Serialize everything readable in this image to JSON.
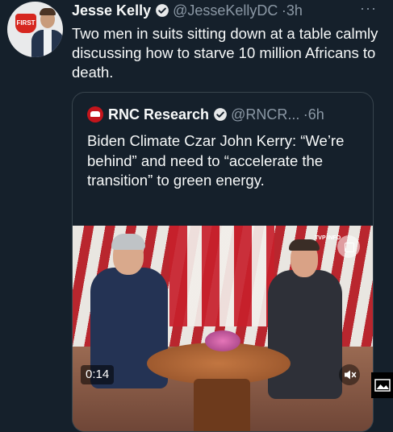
{
  "tweet": {
    "author_name": "Jesse Kelly",
    "handle": "@JesseKellyDC",
    "separator": "·",
    "time": "3h",
    "more": "···",
    "avatar_badge": "FIRST",
    "text": "Two men in suits sitting down at a table calmly discussing how to starve 10 million Africans to death."
  },
  "quote": {
    "author_name": "RNC Research",
    "handle": "@RNCR...",
    "separator": "·",
    "time": "6h",
    "text": "Biden Climate Czar John Kerry: “We’re behind” and need to “accelerate the transition” to green energy.",
    "video": {
      "duration": "0:14",
      "watermark": "TVP INFO"
    }
  },
  "colors": {
    "background": "#15202b",
    "text": "#f7f9f9",
    "secondary_text": "#8b98a5",
    "border": "#38444d",
    "verified": "#e7e9ea"
  },
  "icons": {
    "verified": "verified-badge-icon",
    "more": "more-dots-icon",
    "captions": "captions-icon",
    "mute": "mute-speaker-icon",
    "image": "image-icon"
  }
}
